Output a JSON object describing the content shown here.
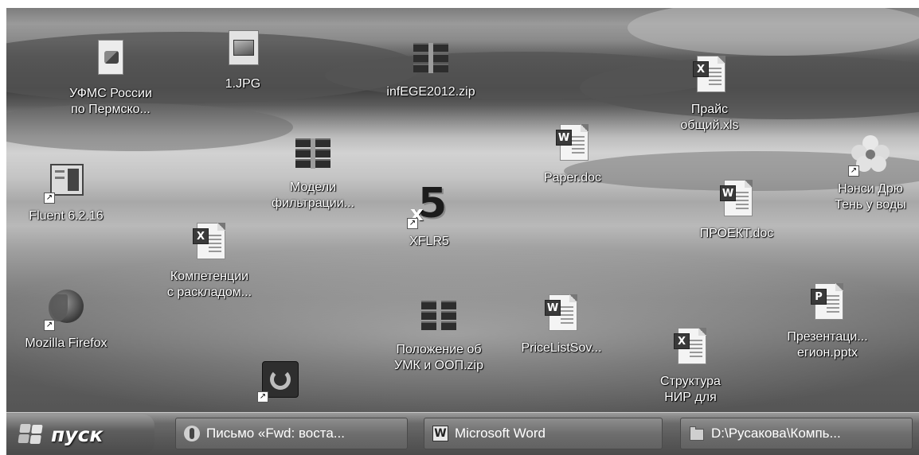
{
  "desktop": {
    "icons": [
      {
        "id": "ufms",
        "label": "УФМС России\nпо Пермско...",
        "icon": "installer-icon",
        "shortcut": false
      },
      {
        "id": "jpg",
        "label": "1.JPG",
        "icon": "image-file-icon",
        "shortcut": false
      },
      {
        "id": "infege",
        "label": "infEGE2012.zip",
        "icon": "winrar-archive-icon",
        "shortcut": false
      },
      {
        "id": "price",
        "label": "Прайс\nобщий.xls",
        "icon": "excel-document-icon",
        "shortcut": false
      },
      {
        "id": "models",
        "label": "Модели\nфильтрации...",
        "icon": "winrar-archive-icon",
        "shortcut": false
      },
      {
        "id": "paper",
        "label": "Paper.doc",
        "icon": "word-document-icon",
        "shortcut": false
      },
      {
        "id": "nancy",
        "label": "Нэнси Дрю\nТень у воды",
        "icon": "flower-icon",
        "shortcut": true
      },
      {
        "id": "fluent",
        "label": "Fluent 6.2.16",
        "icon": "fluent-app-icon",
        "shortcut": true
      },
      {
        "id": "xflr5",
        "label": "XFLR5",
        "icon": "xflr5-app-icon",
        "shortcut": true
      },
      {
        "id": "project",
        "label": "ПРОЕКТ.doc",
        "icon": "word-document-icon",
        "shortcut": false
      },
      {
        "id": "competencies",
        "label": "Компетенции\nс раскладом...",
        "icon": "excel-document-icon",
        "shortcut": false
      },
      {
        "id": "firefox",
        "label": "Mozilla Firefox",
        "icon": "firefox-icon",
        "shortcut": true
      },
      {
        "id": "polozhenie",
        "label": "Положение об\nУМК и ООП.zip",
        "icon": "winrar-archive-icon",
        "shortcut": false
      },
      {
        "id": "pricelist",
        "label": "PriceListSov...",
        "icon": "word-document-icon",
        "shortcut": false
      },
      {
        "id": "presentation",
        "label": "Презентаци...\nегион.pptx",
        "icon": "powerpoint-document-icon",
        "shortcut": false
      },
      {
        "id": "structure",
        "label": "Структура\nНИР для",
        "icon": "excel-document-icon",
        "shortcut": false
      },
      {
        "id": "update",
        "label": "",
        "icon": "update-app-icon",
        "shortcut": true
      }
    ]
  },
  "taskbar": {
    "start_label": "пуск",
    "tasks": [
      {
        "label": "Письмо «Fwd: воста...",
        "icon": "mail-message-icon"
      },
      {
        "label": "Microsoft Word",
        "icon": "word-app-icon"
      },
      {
        "label": "D:\\Русакова\\Компь...",
        "icon": "folder-icon"
      }
    ]
  }
}
